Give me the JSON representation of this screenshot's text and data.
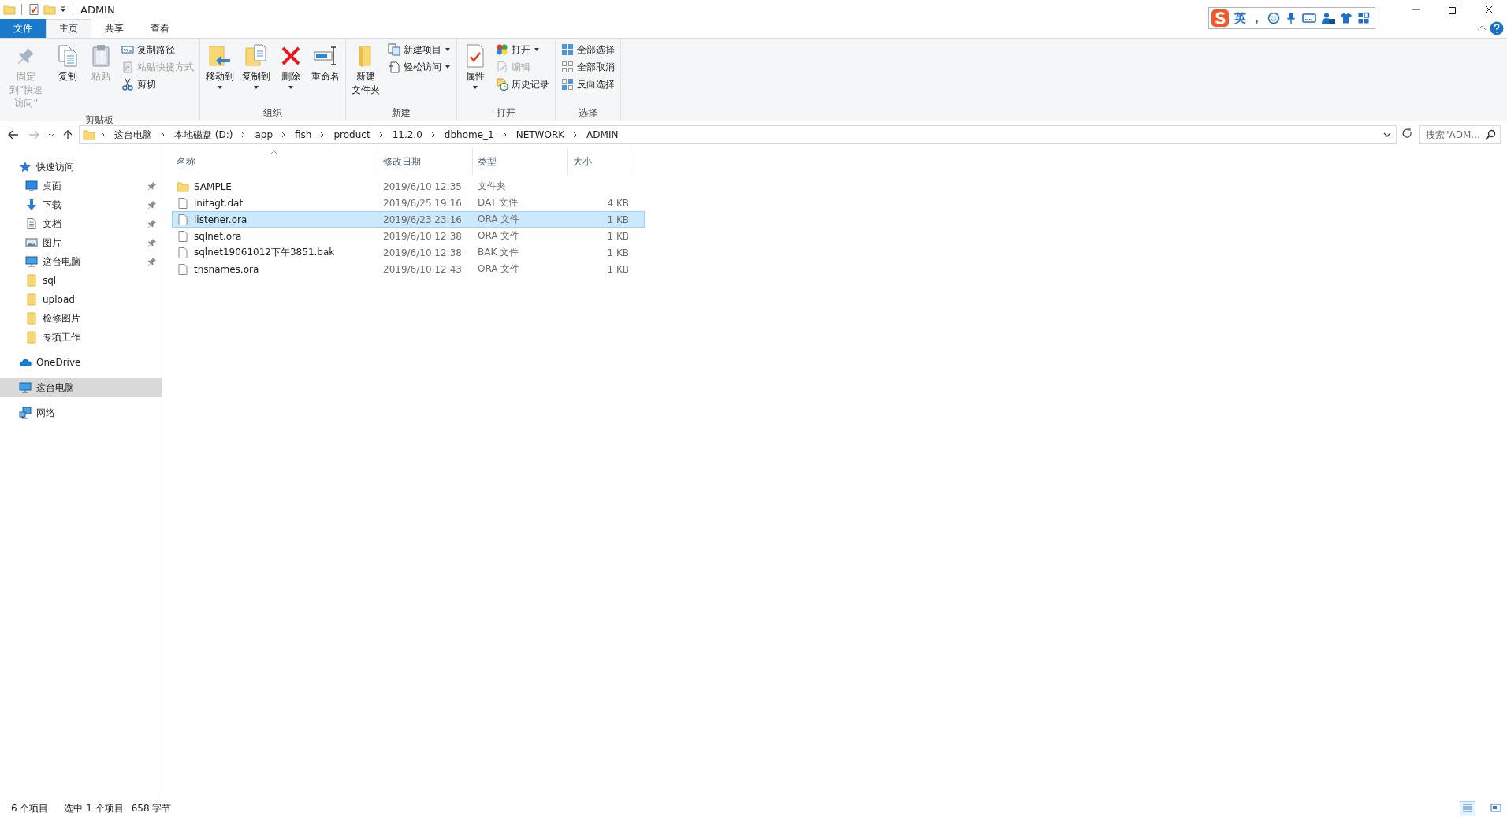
{
  "window": {
    "title": "ADMIN"
  },
  "ime_toolbar": {
    "mode": "英",
    "punctuation": "，"
  },
  "tabs": [
    {
      "label": "文件",
      "kind": "file",
      "selected": false
    },
    {
      "label": "主页",
      "kind": "tab",
      "selected": true
    },
    {
      "label": "共享",
      "kind": "tab",
      "selected": false
    },
    {
      "label": "查看",
      "kind": "tab",
      "selected": false
    }
  ],
  "ribbon": {
    "groups": [
      {
        "label": "剪贴板",
        "items": [
          {
            "label": "固定到“快速访问”",
            "kind": "large",
            "disabled": true,
            "dropdown": false
          },
          {
            "label": "复制",
            "kind": "large",
            "disabled": false,
            "dropdown": false
          },
          {
            "label": "粘贴",
            "kind": "large",
            "disabled": true,
            "dropdown": false
          },
          {
            "label": "复制路径",
            "kind": "small",
            "disabled": false,
            "dropdown": false
          },
          {
            "label": "粘贴快捷方式",
            "kind": "small",
            "disabled": true,
            "dropdown": false
          },
          {
            "label": "剪切",
            "kind": "small",
            "disabled": false,
            "dropdown": false
          }
        ]
      },
      {
        "label": "组织",
        "items": [
          {
            "label": "移动到",
            "kind": "large",
            "disabled": false,
            "dropdown": true
          },
          {
            "label": "复制到",
            "kind": "large",
            "disabled": false,
            "dropdown": true
          },
          {
            "label": "删除",
            "kind": "large",
            "disabled": false,
            "dropdown": true
          },
          {
            "label": "重命名",
            "kind": "large",
            "disabled": false,
            "dropdown": false
          }
        ]
      },
      {
        "label": "新建",
        "items": [
          {
            "label": "新建文件夹",
            "kind": "large",
            "disabled": false,
            "dropdown": false
          },
          {
            "label": "新建项目",
            "kind": "small",
            "disabled": false,
            "dropdown": true
          },
          {
            "label": "轻松访问",
            "kind": "small",
            "disabled": false,
            "dropdown": true
          }
        ]
      },
      {
        "label": "打开",
        "items": [
          {
            "label": "属性",
            "kind": "large",
            "disabled": false,
            "dropdown": true
          },
          {
            "label": "打开",
            "kind": "small",
            "disabled": false,
            "dropdown": true
          },
          {
            "label": "编辑",
            "kind": "small",
            "disabled": true,
            "dropdown": false
          },
          {
            "label": "历史记录",
            "kind": "small",
            "disabled": false,
            "dropdown": false
          }
        ]
      },
      {
        "label": "选择",
        "items": [
          {
            "label": "全部选择",
            "kind": "small",
            "disabled": false,
            "dropdown": false
          },
          {
            "label": "全部取消",
            "kind": "small",
            "disabled": false,
            "dropdown": false
          },
          {
            "label": "反向选择",
            "kind": "small",
            "disabled": false,
            "dropdown": false
          }
        ]
      }
    ]
  },
  "address_bar": {
    "path": [
      "这台电脑",
      "本地磁盘 (D:)",
      "app",
      "fish",
      "product",
      "11.2.0",
      "dbhome_1",
      "NETWORK",
      "ADMIN"
    ]
  },
  "search": {
    "placeholder": "搜索\"ADM..."
  },
  "sidebar": {
    "items": [
      {
        "label": "快速访问",
        "kind": "quick",
        "selected": false,
        "children": [
          {
            "label": "桌面",
            "kind": "desktop",
            "pinned": true,
            "selected": false
          },
          {
            "label": "下载",
            "kind": "download",
            "pinned": true,
            "selected": false
          },
          {
            "label": "文档",
            "kind": "document",
            "pinned": true,
            "selected": false
          },
          {
            "label": "图片",
            "kind": "pictures",
            "pinned": true,
            "selected": false
          },
          {
            "label": "这台电脑",
            "kind": "pc",
            "pinned": true,
            "selected": false
          },
          {
            "label": "sql",
            "kind": "folder",
            "pinned": false,
            "selected": false
          },
          {
            "label": "upload",
            "kind": "folder",
            "pinned": false,
            "selected": false
          },
          {
            "label": "检修图片",
            "kind": "folder",
            "pinned": false,
            "selected": false
          },
          {
            "label": "专项工作",
            "kind": "folder",
            "pinned": false,
            "selected": false
          }
        ]
      },
      {
        "label": "OneDrive",
        "kind": "cloud",
        "selected": false
      },
      {
        "label": "这台电脑",
        "kind": "pc",
        "selected": true
      },
      {
        "label": "网络",
        "kind": "network",
        "selected": false
      }
    ]
  },
  "table": {
    "columns": [
      {
        "label": "名称",
        "sorted": true
      },
      {
        "label": "修改日期",
        "sorted": false
      },
      {
        "label": "类型",
        "sorted": false
      },
      {
        "label": "大小",
        "sorted": false
      }
    ],
    "rows": [
      {
        "kind": "folder",
        "name": "SAMPLE",
        "date": "2019/6/10 12:35",
        "type": "文件夹",
        "size": "",
        "selected": false
      },
      {
        "kind": "file",
        "name": "initagt.dat",
        "date": "2019/6/25 19:16",
        "type": "DAT 文件",
        "size": "4 KB",
        "selected": false
      },
      {
        "kind": "file",
        "name": "listener.ora",
        "date": "2019/6/23 23:16",
        "type": "ORA 文件",
        "size": "1 KB",
        "selected": true
      },
      {
        "kind": "file",
        "name": "sqlnet.ora",
        "date": "2019/6/10 12:38",
        "type": "ORA 文件",
        "size": "1 KB",
        "selected": false
      },
      {
        "kind": "file",
        "name": "sqlnet19061012下午3851.bak",
        "date": "2019/6/10 12:38",
        "type": "BAK 文件",
        "size": "1 KB",
        "selected": false
      },
      {
        "kind": "file",
        "name": "tnsnames.ora",
        "date": "2019/6/10 12:43",
        "type": "ORA 文件",
        "size": "1 KB",
        "selected": false
      }
    ]
  },
  "status_bar": {
    "items": [
      "6 个项目",
      "选中 1 个项目",
      "658 字节"
    ],
    "views": [
      {
        "kind": "details",
        "selected": true
      },
      {
        "kind": "large_icons",
        "selected": false
      }
    ]
  }
}
